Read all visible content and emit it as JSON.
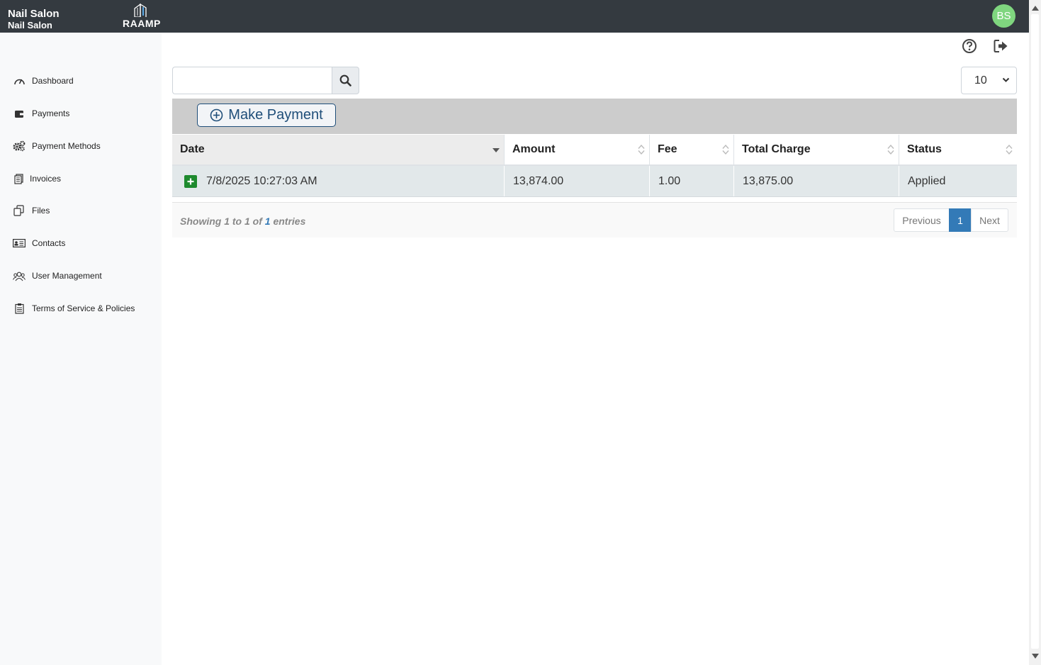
{
  "brand": {
    "line1": "Nail Salon",
    "line2": "Nail Salon",
    "logo_text": "RAAMP"
  },
  "user": {
    "initials": "BS",
    "avatar_color": "#7fd67f"
  },
  "sidebar": {
    "items": [
      {
        "label": "Dashboard",
        "icon": "gauge-icon"
      },
      {
        "label": "Payments",
        "icon": "wallet-icon"
      },
      {
        "label": "Payment Methods",
        "icon": "gears-icon"
      },
      {
        "label": "Invoices",
        "icon": "invoice-icon"
      },
      {
        "label": "Files",
        "icon": "files-icon"
      },
      {
        "label": "Contacts",
        "icon": "contact-card-icon"
      },
      {
        "label": "User Management",
        "icon": "users-icon"
      },
      {
        "label": "Terms of Service & Policies",
        "icon": "clipboard-icon"
      }
    ]
  },
  "search": {
    "value": "",
    "placeholder": ""
  },
  "page_length": {
    "selected": "10"
  },
  "toolbar": {
    "make_payment_label": "Make Payment"
  },
  "table": {
    "columns": [
      "Date",
      "Amount",
      "Fee",
      "Total Charge",
      "Status"
    ],
    "rows": [
      {
        "date": "7/8/2025 10:27:03 AM",
        "amount": "13,874.00",
        "fee": "1.00",
        "total_charge": "13,875.00",
        "status": "Applied"
      }
    ]
  },
  "footer": {
    "info_prefix": "Showing 1 to 1 of ",
    "info_total": "1",
    "info_suffix": " entries",
    "previous_label": "Previous",
    "current_page": "1",
    "next_label": "Next"
  },
  "colors": {
    "topbar": "#343a40",
    "accent": "#337ab7",
    "button_border": "#1f4e79",
    "expand_green": "#1e8a2e"
  }
}
